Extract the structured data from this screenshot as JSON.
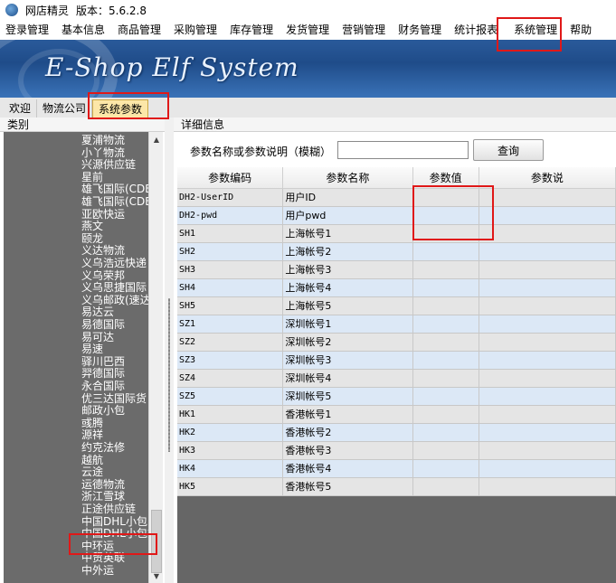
{
  "window": {
    "app_name": "网店精灵",
    "version_label": "版本：5.6.2.8"
  },
  "menu": [
    "登录管理",
    "基本信息",
    "商品管理",
    "采购管理",
    "库存管理",
    "发货管理",
    "营销管理",
    "财务管理",
    "统计报表",
    "系统管理",
    "帮助"
  ],
  "banner": {
    "title": "E-Shop Elf System"
  },
  "tabs": [
    "欢迎",
    "物流公司",
    "系统参数"
  ],
  "left_panel": {
    "header": "类别",
    "items": [
      "夏浦物流",
      "小丫物流",
      "兴源供应链",
      "星前",
      "雄飞国际(CDEK",
      "雄飞国际(CDEK",
      "亚欧快运",
      "燕文",
      "颐龙",
      "义达物流",
      "义乌浩远快递",
      "义乌荣邦",
      "义乌思捷国际",
      "义乌邮政(速达",
      "易达云",
      "易德国际",
      "易可达",
      "易速",
      "驿川巴西",
      "羿德国际",
      "永合国际",
      "优三达国际货",
      "邮政小包",
      "彧腾",
      "源祥",
      "约克法修",
      "越航",
      "云途",
      "运德物流",
      "浙江雪球",
      "正途供应链",
      "中国DHL小包",
      "中国DHL小包挂",
      "中环运",
      "中贸英联",
      "中外运"
    ]
  },
  "right_panel": {
    "header": "详细信息",
    "search": {
      "label": "参数名称或参数说明（模糊）",
      "value": "",
      "button": "查询"
    },
    "columns": [
      "参数编码",
      "参数名称",
      "参数值",
      "参数说"
    ],
    "rows": [
      [
        "DH2-UserID",
        "用户ID",
        ""
      ],
      [
        "DH2-pwd",
        "用户pwd",
        ""
      ],
      [
        "SH1",
        "上海帐号1",
        ""
      ],
      [
        "SH2",
        "上海帐号2",
        ""
      ],
      [
        "SH3",
        "上海帐号3",
        ""
      ],
      [
        "SH4",
        "上海帐号4",
        ""
      ],
      [
        "SH5",
        "上海帐号5",
        ""
      ],
      [
        "SZ1",
        "深圳帐号1",
        ""
      ],
      [
        "SZ2",
        "深圳帐号2",
        ""
      ],
      [
        "SZ3",
        "深圳帐号3",
        ""
      ],
      [
        "SZ4",
        "深圳帐号4",
        ""
      ],
      [
        "SZ5",
        "深圳帐号5",
        ""
      ],
      [
        "HK1",
        "香港帐号1",
        ""
      ],
      [
        "HK2",
        "香港帐号2",
        ""
      ],
      [
        "HK3",
        "香港帐号3",
        ""
      ],
      [
        "HK4",
        "香港帐号4",
        ""
      ],
      [
        "HK5",
        "香港帐号5",
        ""
      ]
    ]
  },
  "colors": {
    "highlight": "#e01818",
    "active_tab": "#fce7a8",
    "row_alt": "#dce8f6",
    "list_bg": "#6b6b6b"
  }
}
